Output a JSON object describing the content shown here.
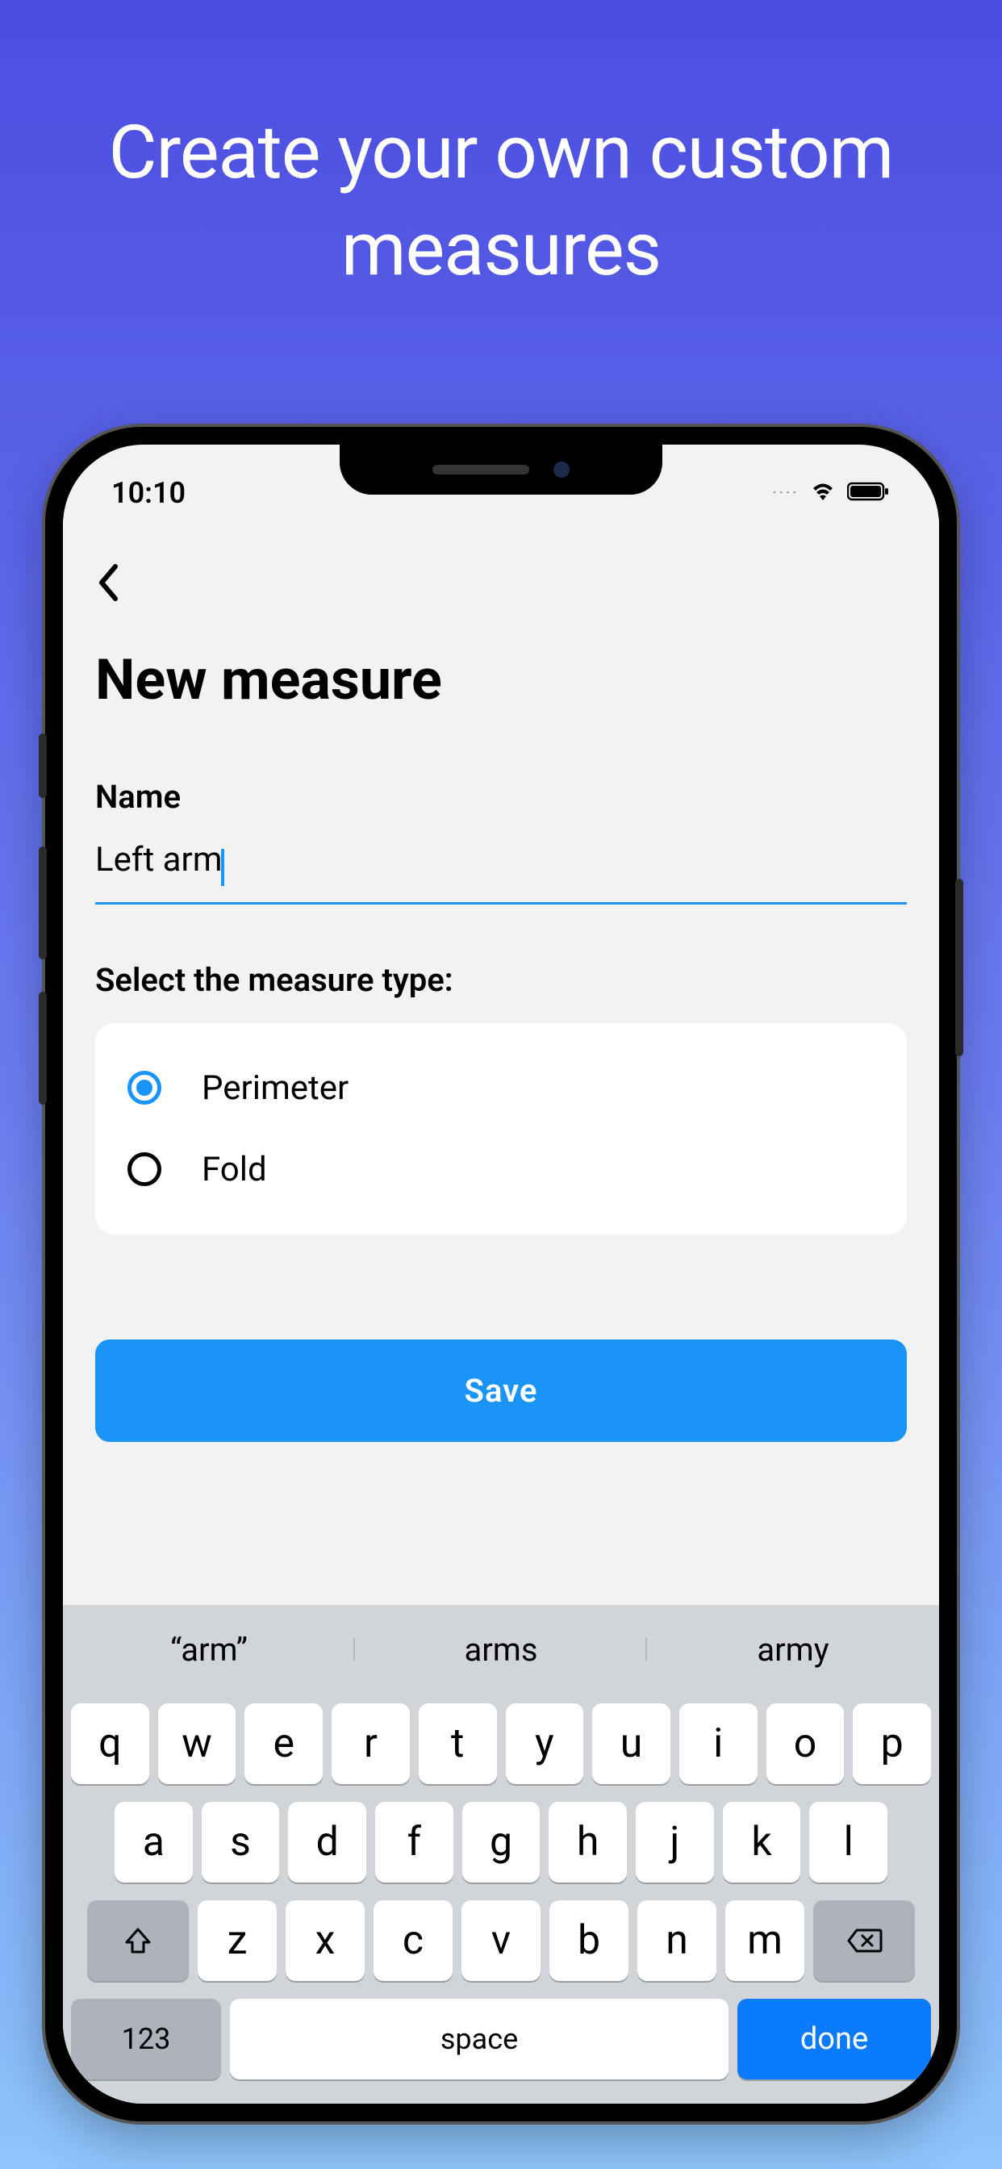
{
  "promo": {
    "title": "Create your own custom measures"
  },
  "status": {
    "time": "10:10"
  },
  "header": {
    "page_title": "New measure"
  },
  "form": {
    "name_label": "Name",
    "name_value": "Left arm",
    "type_label": "Select the measure type:",
    "options": [
      {
        "label": "Perimeter",
        "selected": true
      },
      {
        "label": "Fold",
        "selected": false
      }
    ],
    "save_label": "Save"
  },
  "keyboard": {
    "suggestions": [
      "“arm”",
      "arms",
      "army"
    ],
    "row1": [
      "q",
      "w",
      "e",
      "r",
      "t",
      "y",
      "u",
      "i",
      "o",
      "p"
    ],
    "row2": [
      "a",
      "s",
      "d",
      "f",
      "g",
      "h",
      "j",
      "k",
      "l"
    ],
    "row3": [
      "z",
      "x",
      "c",
      "v",
      "b",
      "n",
      "m"
    ],
    "numbers_label": "123",
    "space_label": "space",
    "done_label": "done"
  }
}
